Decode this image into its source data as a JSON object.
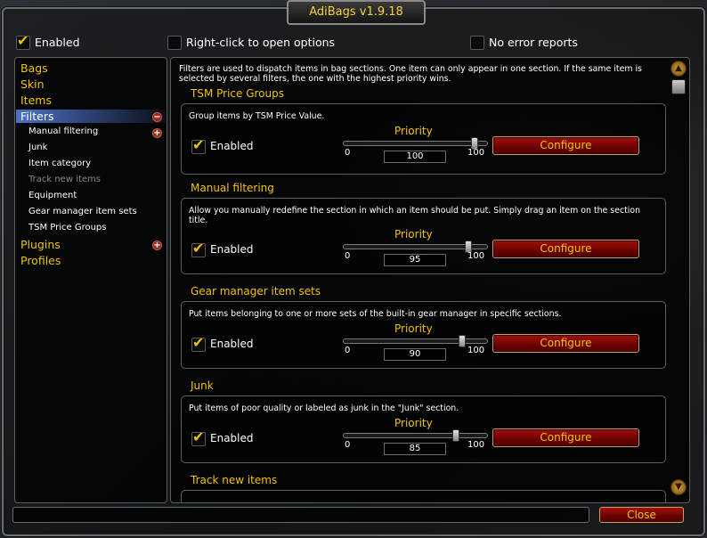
{
  "window": {
    "title": "AdiBags v1.9.18"
  },
  "top_options": {
    "enabled": {
      "label": "Enabled",
      "checked": true
    },
    "right_click": {
      "label": "Right-click to open options",
      "checked": false
    },
    "no_errors": {
      "label": "No error reports",
      "checked": false
    }
  },
  "sidebar": {
    "items": [
      {
        "label": "Bags"
      },
      {
        "label": "Skin"
      },
      {
        "label": "Items"
      },
      {
        "label": "Filters",
        "selected": true,
        "expanded": true
      },
      {
        "label": "Plugins",
        "expanded": false
      },
      {
        "label": "Profiles"
      }
    ],
    "filters_children": [
      {
        "label": "Manual filtering",
        "has_children": true
      },
      {
        "label": "Junk"
      },
      {
        "label": "Item category"
      },
      {
        "label": "Track new items",
        "dimmed": true
      },
      {
        "label": "Equipment"
      },
      {
        "label": "Gear manager item sets"
      },
      {
        "label": "TSM Price Groups"
      }
    ]
  },
  "content": {
    "intro": "Filters are used to dispatch items in bag sections. One item can only appear in one section. If the same item is selected by several filters, the one with the highest priority wins.",
    "priority_label": "Priority",
    "enabled_label": "Enabled",
    "configure_label": "Configure",
    "slider_min": "0",
    "slider_max": "100",
    "filters": [
      {
        "title": "TSM Price Groups",
        "description": "Group items by TSM Price Value.",
        "enabled": true,
        "priority": 100
      },
      {
        "title": "Manual filtering",
        "description": "Allow you manually redefine the section in which an item should be put. Simply drag an item on the section title.",
        "enabled": true,
        "priority": 95
      },
      {
        "title": "Gear manager item sets",
        "description": "Put items belonging to one or more sets of the built-in gear manager in specific sections.",
        "enabled": true,
        "priority": 90
      },
      {
        "title": "Junk",
        "description": "Put items of poor quality or labeled as junk in the \"Junk\" section.",
        "enabled": true,
        "priority": 85
      },
      {
        "title": "Track new items"
      }
    ]
  },
  "footer": {
    "close_label": "Close"
  },
  "colors": {
    "accent_gold": "#f2c300",
    "selection_blue": "#5078d2",
    "button_red": "#8a0a05"
  }
}
